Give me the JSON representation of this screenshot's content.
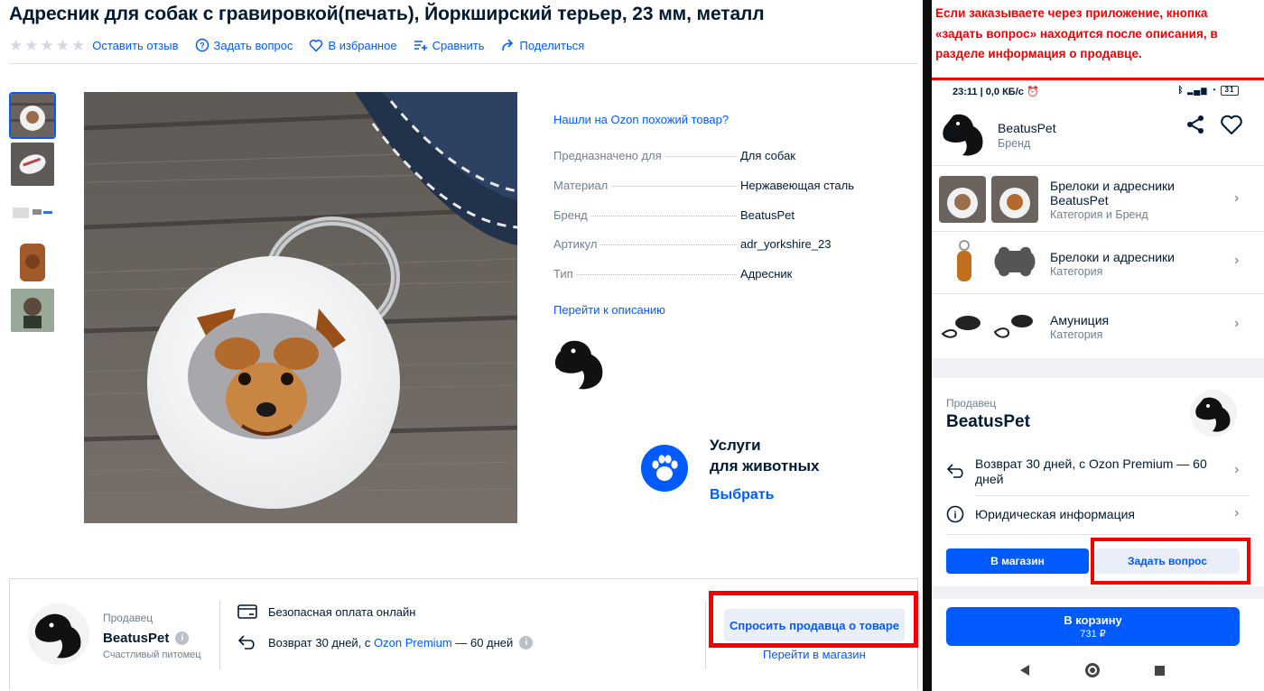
{
  "product": {
    "title": "Адресник для собак с гравировкой(печать), Йоркширский терьер, 23 мм, металл",
    "actions": [
      {
        "label": "Оставить отзыв"
      },
      {
        "label": "Задать вопрос"
      },
      {
        "label": "В избранное"
      },
      {
        "label": "Сравнить"
      },
      {
        "label": "Поделиться"
      }
    ],
    "rating_stars": 5,
    "rating_value": 0,
    "thumbnails_count": 5,
    "similar_link": "Нашли на Ozon похожий товар?",
    "specs": [
      {
        "key": "Предназначено для",
        "value": "Для собак",
        "is_link": true
      },
      {
        "key": "Материал",
        "value": "Нержавеющая сталь",
        "is_link": false
      },
      {
        "key": "Бренд",
        "value": "BeatusPet",
        "is_link": true
      },
      {
        "key": "Артикул",
        "value": "adr_yorkshire_23",
        "is_link": false
      },
      {
        "key": "Тип",
        "value": "Адресник",
        "is_link": false
      }
    ],
    "description_link": "Перейти к описанию",
    "promo": {
      "line1": "Услуги",
      "line2": "для животных",
      "cta": "Выбрать"
    }
  },
  "seller_block": {
    "label": "Продавец",
    "name": "BeatusPet",
    "subtitle": "Счастливый питомец",
    "feature1": "Безопасная оплата онлайн",
    "feature2_prefix": "Возврат 30 дней, с ",
    "feature2_link": "Ozon Premium",
    "feature2_suffix": " — 60 дней",
    "ask_button": "Спросить продавца о товаре",
    "shop_link": "Перейти в магазин"
  },
  "phone": {
    "note": "Если заказываете через приложение, кнопка «задать вопрос» находится после описания, в разделе информация о продавце.",
    "status": {
      "time": "23:11",
      "speed": "0,0 КБ/с",
      "battery": "31"
    },
    "brand": {
      "name": "BeatusPet",
      "sub": "Бренд"
    },
    "categories": [
      {
        "title1": "Брелоки и адресники",
        "title2": "BeatusPet",
        "sub": "Категория и Бренд"
      },
      {
        "title1": "Брелоки и адресники",
        "title2": "",
        "sub": "Категория"
      },
      {
        "title1": "Амуниция",
        "title2": "",
        "sub": "Категория"
      }
    ],
    "seller": {
      "label": "Продавец",
      "name": "BeatusPet",
      "return_text": "Возврат 30 дней, с Ozon Premium — 60 дней",
      "legal_text": "Юридическая информация",
      "btn_shop": "В магазин",
      "btn_ask": "Задать вопрос"
    },
    "cart": {
      "label": "В корзину",
      "price": "731 ₽"
    }
  },
  "colors": {
    "accent": "#005bff",
    "highlight": "#f40000",
    "text": "#001a34",
    "muted": "#707f8d"
  }
}
